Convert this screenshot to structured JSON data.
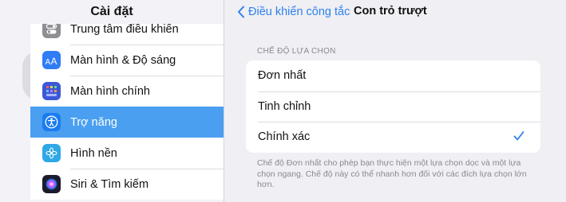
{
  "sidebar": {
    "title": "Cài đặt",
    "items": [
      {
        "label": "Trung tâm điều khiển",
        "icon": "control-center-icon",
        "color": "#8e8e93"
      },
      {
        "label": "Màn hình & Độ sáng",
        "icon": "display-brightness-icon",
        "color": "#2f7cf6"
      },
      {
        "label": "Màn hình chính",
        "icon": "home-screen-icon",
        "color": "#3c58d6"
      },
      {
        "label": "Trợ năng",
        "icon": "accessibility-icon",
        "color": "#1a7cf0",
        "selected": true
      },
      {
        "label": "Hình nền",
        "icon": "wallpaper-icon",
        "color": "#2fa8e6"
      },
      {
        "label": "Siri & Tìm kiếm",
        "icon": "siri-icon",
        "color": "#1c1c2e"
      }
    ]
  },
  "detail": {
    "back_label": "Điều khiển công tắc",
    "title": "Con trỏ trượt",
    "section_header": "CHẾ ĐỘ LỰA CHỌN",
    "options": [
      {
        "label": "Đơn nhất",
        "checked": false
      },
      {
        "label": "Tinh chỉnh",
        "checked": false
      },
      {
        "label": "Chính xác",
        "checked": true
      }
    ],
    "footer": "Chế độ Đơn nhất cho phép bạn thực hiện một lựa chọn dọc và một lựa chọn ngang. Chế độ này có thể nhanh hơn đối với các đích lựa chọn lớn hơn."
  },
  "colors": {
    "accent": "#2f80ed",
    "selected_row": "#4a9ff0",
    "background": "#efeff4"
  }
}
